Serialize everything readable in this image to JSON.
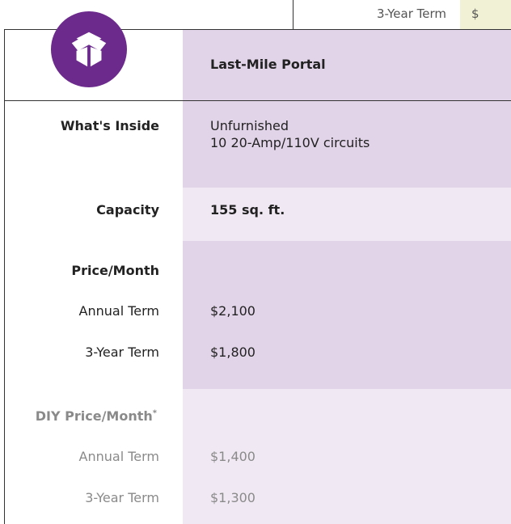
{
  "top_strip": {
    "label": "3-Year Term",
    "value_partial": "$"
  },
  "product": {
    "name": "Last-Mile Portal"
  },
  "rows": {
    "whats_inside": {
      "label": "What's Inside",
      "line1": "Unfurnished",
      "line2": "10 20-Amp/110V circuits"
    },
    "capacity": {
      "label": "Capacity",
      "value": "155 sq. ft."
    },
    "price": {
      "heading": "Price/Month",
      "annual_label": "Annual Term",
      "annual_value": "$2,100",
      "three_year_label": "3-Year Term",
      "three_year_value": "$1,800"
    },
    "diy_price": {
      "heading": "DIY Price/Month",
      "heading_mark": "*",
      "annual_label": "Annual Term",
      "annual_value": "$1,400",
      "three_year_label": "3-Year Term",
      "three_year_value": "$1,300"
    }
  },
  "colors": {
    "logo": "#6b2a8c",
    "band_dark": "#e2d4e8",
    "band_light": "#f0e8f2",
    "top_cell": "#f1f1d6"
  },
  "icons": {
    "logo": "open-box-icon"
  }
}
